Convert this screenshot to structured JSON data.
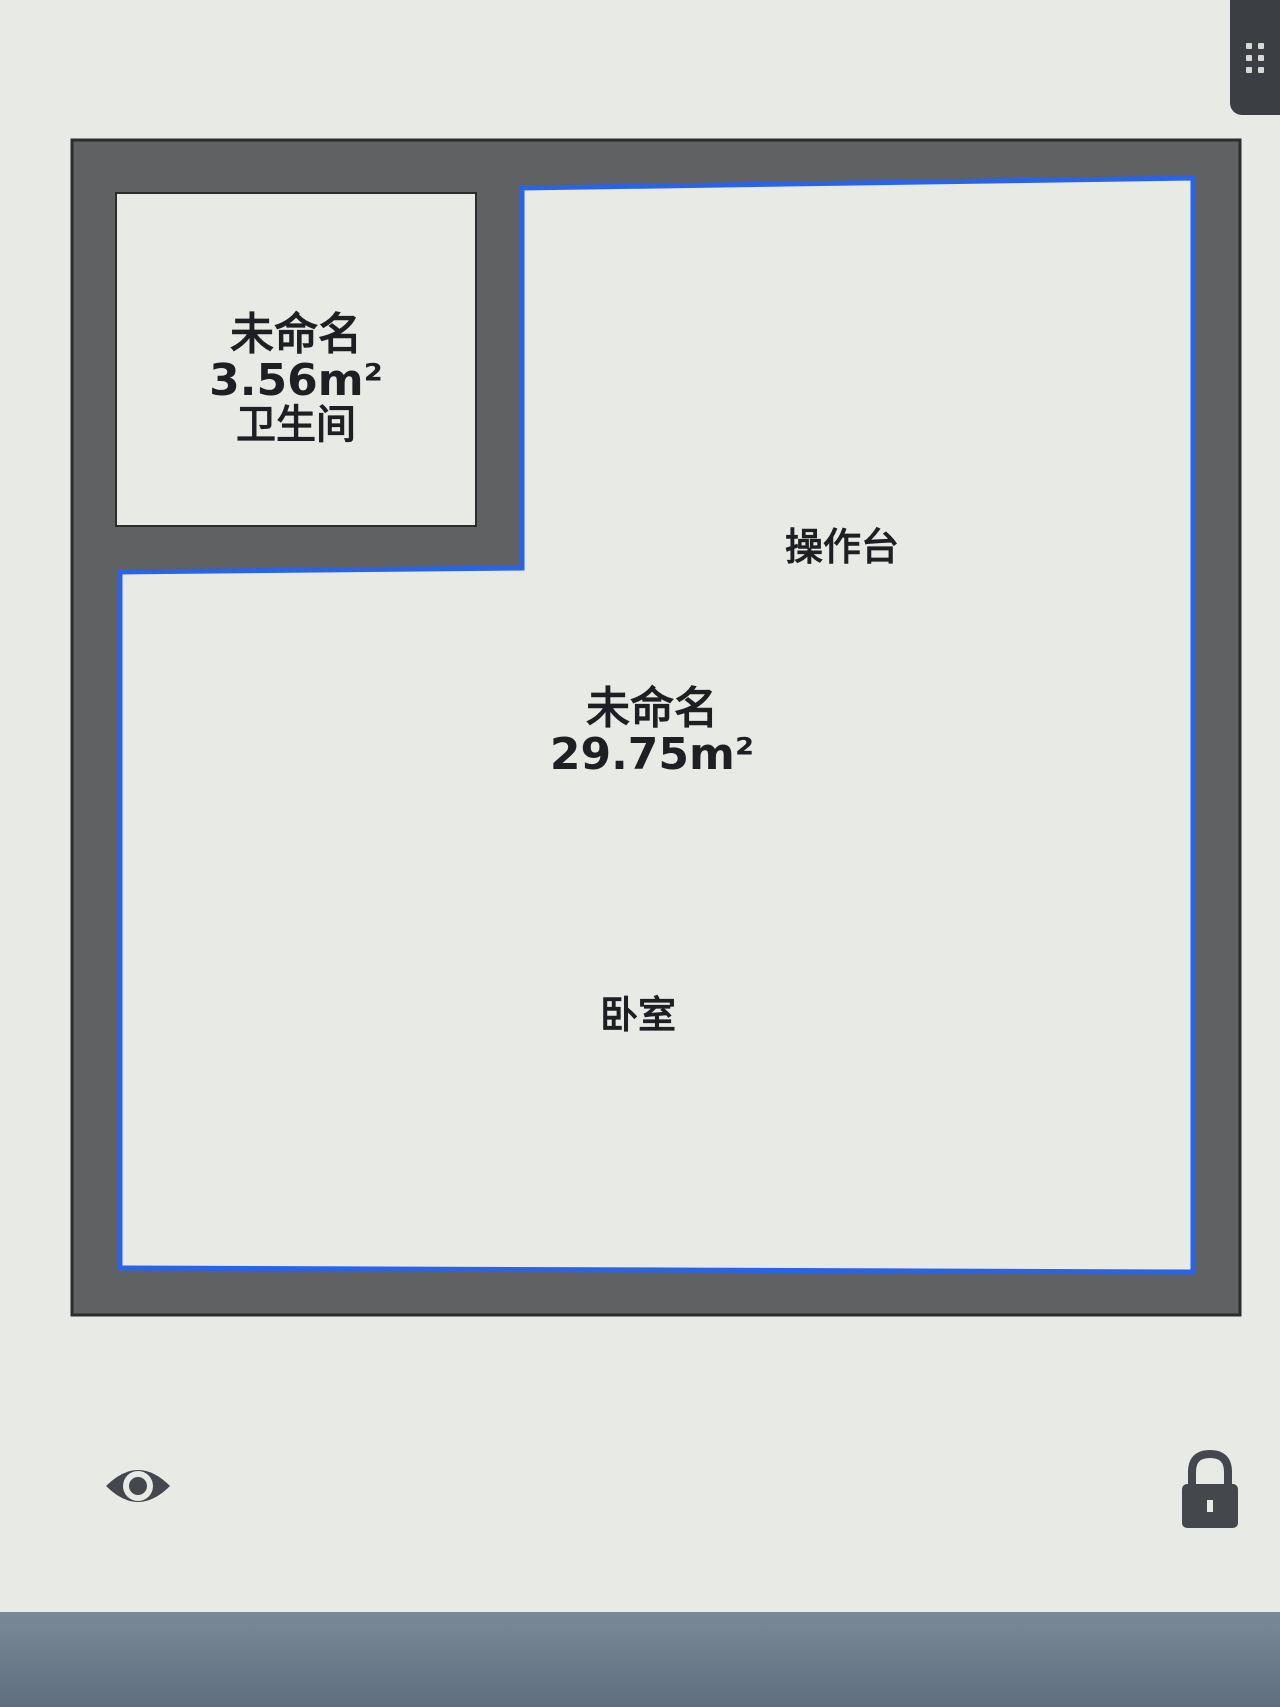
{
  "rooms": [
    {
      "name": "未命名",
      "area": "3.56m²",
      "type": "卫生间"
    },
    {
      "name": "未命名",
      "area": "29.75m²"
    }
  ],
  "fixtures": [
    {
      "label": "操作台"
    },
    {
      "label": "卧室"
    }
  ],
  "toolbar": {
    "visibility_icon": "eye-icon",
    "lock_icon": "lock-icon"
  },
  "colors": {
    "wall": "#5f6163",
    "floor": "#e8eae6",
    "selection": "#2a63e6",
    "text": "#1d1f22"
  }
}
